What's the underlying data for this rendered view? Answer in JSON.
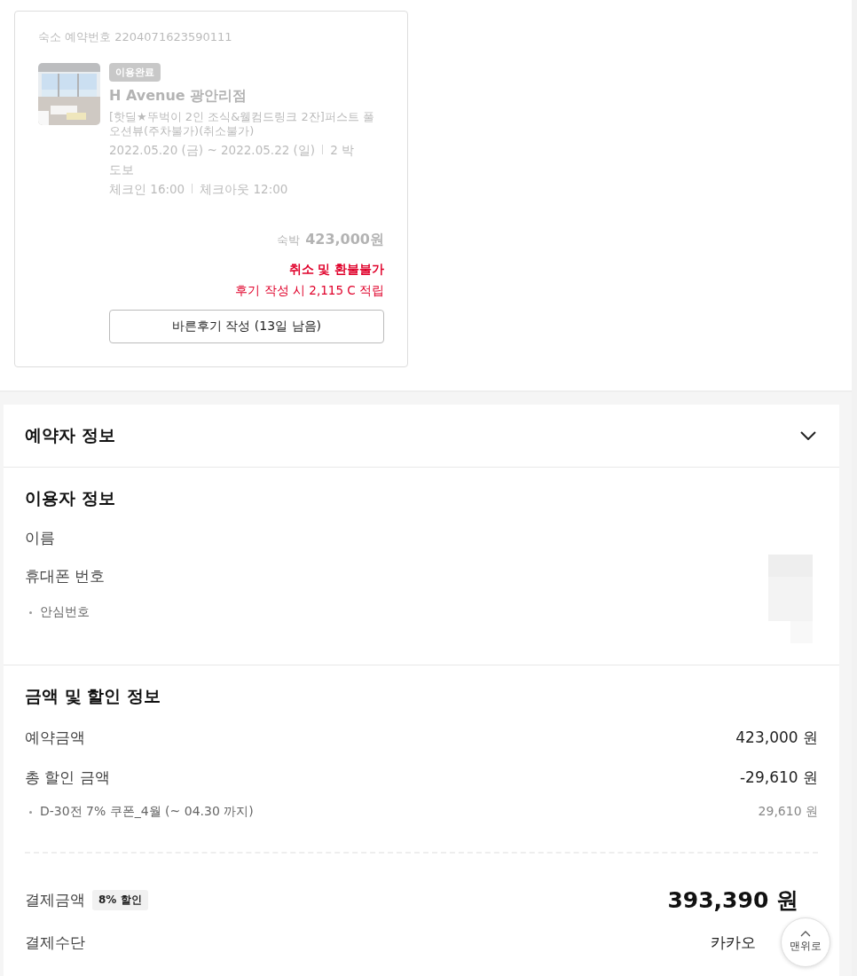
{
  "booking_card": {
    "booking_number": "숙소 예약번호 2204071623590111",
    "dimmed": true,
    "status_badge": "이용완료",
    "hotel_name": "H Avenue 광안리점",
    "room_name": "[핫딜★뚜벅이 2인 조식&웰컴드링크 2잔]퍼스트 풀오션뷰(주차불가)(취소불가)",
    "dates": "2022.05.20 (금) ~ 2022.05.22 (일)",
    "nights": "2 박",
    "access": "도보",
    "checkin": "체크인 16:00",
    "checkout": "체크아웃 12:00",
    "price_label": "숙박",
    "price": "423,000원",
    "refund_notice": "취소 및 환불불가",
    "review_reward": "후기 작성 시 2,115 C 적립",
    "review_button": "바른후기 작성 (13일 남음)"
  },
  "booker_section": {
    "title": "예약자 정보",
    "expanded": false
  },
  "user_section": {
    "title": "이용자 정보",
    "rows": [
      {
        "label": "이름",
        "kind": "main"
      },
      {
        "label": "휴대폰 번호",
        "kind": "main"
      },
      {
        "label": "안심번호",
        "kind": "sub"
      }
    ]
  },
  "payment_section": {
    "title": "금액 및 할인 정보",
    "rows": [
      {
        "label": "예약금액",
        "value": "423,000 원",
        "kind": "main"
      },
      {
        "label": "총 할인 금액",
        "value": "-29,610 원",
        "kind": "main"
      },
      {
        "label": "D-30전 7% 쿠폰_4월 (~ 04.30 까지)",
        "value": "29,610 원",
        "kind": "sub"
      }
    ],
    "total_label": "결제금액",
    "discount_badge": "8% 할인",
    "total_value": "393,390 원",
    "method_label": "결제수단",
    "method_value": "카카오"
  },
  "scroll_top_button": "맨위로"
}
